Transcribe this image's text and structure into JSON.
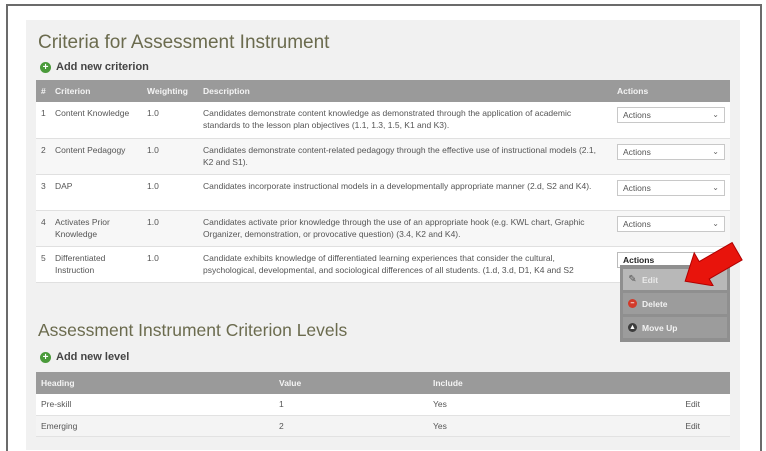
{
  "criteria_section": {
    "title": "Criteria for Assessment Instrument",
    "add_label": "Add new criterion",
    "columns": [
      "#",
      "Criterion",
      "Weighting",
      "Description",
      "Actions"
    ],
    "rows": [
      {
        "num": "1",
        "criterion": "Content Knowledge",
        "weighting": "1.0",
        "description": "Candidates demonstrate content knowledge as demonstrated through the application of academic standards to the lesson plan objectives (1.1, 1.3, 1.5, K1 and K3).",
        "action": "Actions"
      },
      {
        "num": "2",
        "criterion": "Content Pedagogy",
        "weighting": "1.0",
        "description": "Candidates demonstrate content-related pedagogy through the effective use of instructional models (2.1, K2 and S1).",
        "action": "Actions"
      },
      {
        "num": "3",
        "criterion": "DAP",
        "weighting": "1.0",
        "description": "Candidates incorporate instructional models in a developmentally appropriate manner (2.d, S2 and K4).",
        "action": "Actions"
      },
      {
        "num": "4",
        "criterion": "Activates Prior Knowledge",
        "weighting": "1.0",
        "description": "Candidates activate prior knowledge through the use of an appropriate hook (e.g. KWL chart, Graphic Organizer, demonstration, or provocative question) (3.4, K2 and K4).",
        "action": "Actions"
      },
      {
        "num": "5",
        "criterion": "Differentiated Instruction",
        "weighting": "1.0",
        "description": "Candidate exhibits knowledge of differentiated learning experiences that consider the cultural, psychological, developmental, and sociological differences of all students. (1.d, 3.d, D1, K4 and S2",
        "action": "Actions"
      }
    ],
    "dropdown": {
      "edit": "Edit",
      "delete": "Delete",
      "move_up": "Move Up"
    }
  },
  "levels_section": {
    "title": "Assessment Instrument Criterion Levels",
    "add_label": "Add new level",
    "columns": [
      "Heading",
      "Value",
      "Include",
      ""
    ],
    "rows": [
      {
        "heading": "Pre-skill",
        "value": "1",
        "include": "Yes",
        "edit": "Edit"
      },
      {
        "heading": "Emerging",
        "value": "2",
        "include": "Yes",
        "edit": "Edit"
      }
    ]
  },
  "colors": {
    "header_bg": "#9a9a9a",
    "title": "#6b6b4e",
    "add_icon": "#4a9a3a",
    "delete_icon": "#d23a2a",
    "callout_arrow": "#e8140c",
    "link": "#3a78c0"
  }
}
